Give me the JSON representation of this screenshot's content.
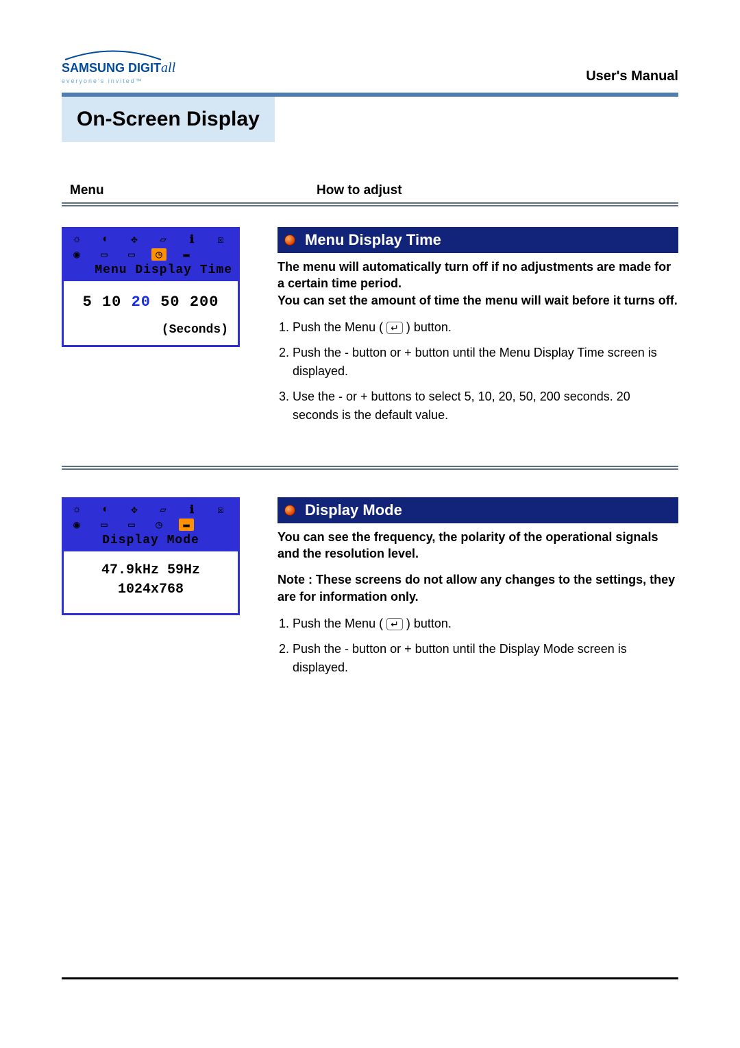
{
  "header": {
    "brand_main": "SAMSUNG DIGIT",
    "brand_italic": "all",
    "tagline": "everyone's invited™",
    "manual_label": "User's Manual"
  },
  "section_title": "On-Screen Display",
  "columns": {
    "menu": "Menu",
    "how_to_adjust": "How to adjust"
  },
  "topics": [
    {
      "osd": {
        "title": "Menu Display Time",
        "values": [
          "5",
          "10",
          "20",
          "50",
          "200"
        ],
        "selected_index": 2,
        "unit_label": "(Seconds)"
      },
      "title": "Menu Display Time",
      "description": "The menu will automatically turn off if no adjustments are made for a certain time period.\nYou can set the amount of time the menu will wait before it turns off.",
      "steps": [
        {
          "pre": "Push the Menu (",
          "post": " ) button."
        },
        {
          "text": "Push the - button or + button until the Menu Display Time screen is displayed."
        },
        {
          "text": "Use the - or + buttons to select 5, 10, 20, 50, 200 seconds. 20 seconds is the default value."
        }
      ]
    },
    {
      "osd": {
        "title": "Display Mode",
        "line1": "47.9kHz 59Hz",
        "line2": "1024x768"
      },
      "title": "Display Mode",
      "description": "You can see the frequency, the polarity of the operational signals and the resolution level.",
      "note": "Note :  These screens do not allow any changes to the settings, they are for information only.",
      "steps": [
        {
          "pre": "Push the Menu (",
          "post": " ) button."
        },
        {
          "text": "Push the - button or + button until the Display Mode screen is displayed."
        }
      ]
    }
  ]
}
